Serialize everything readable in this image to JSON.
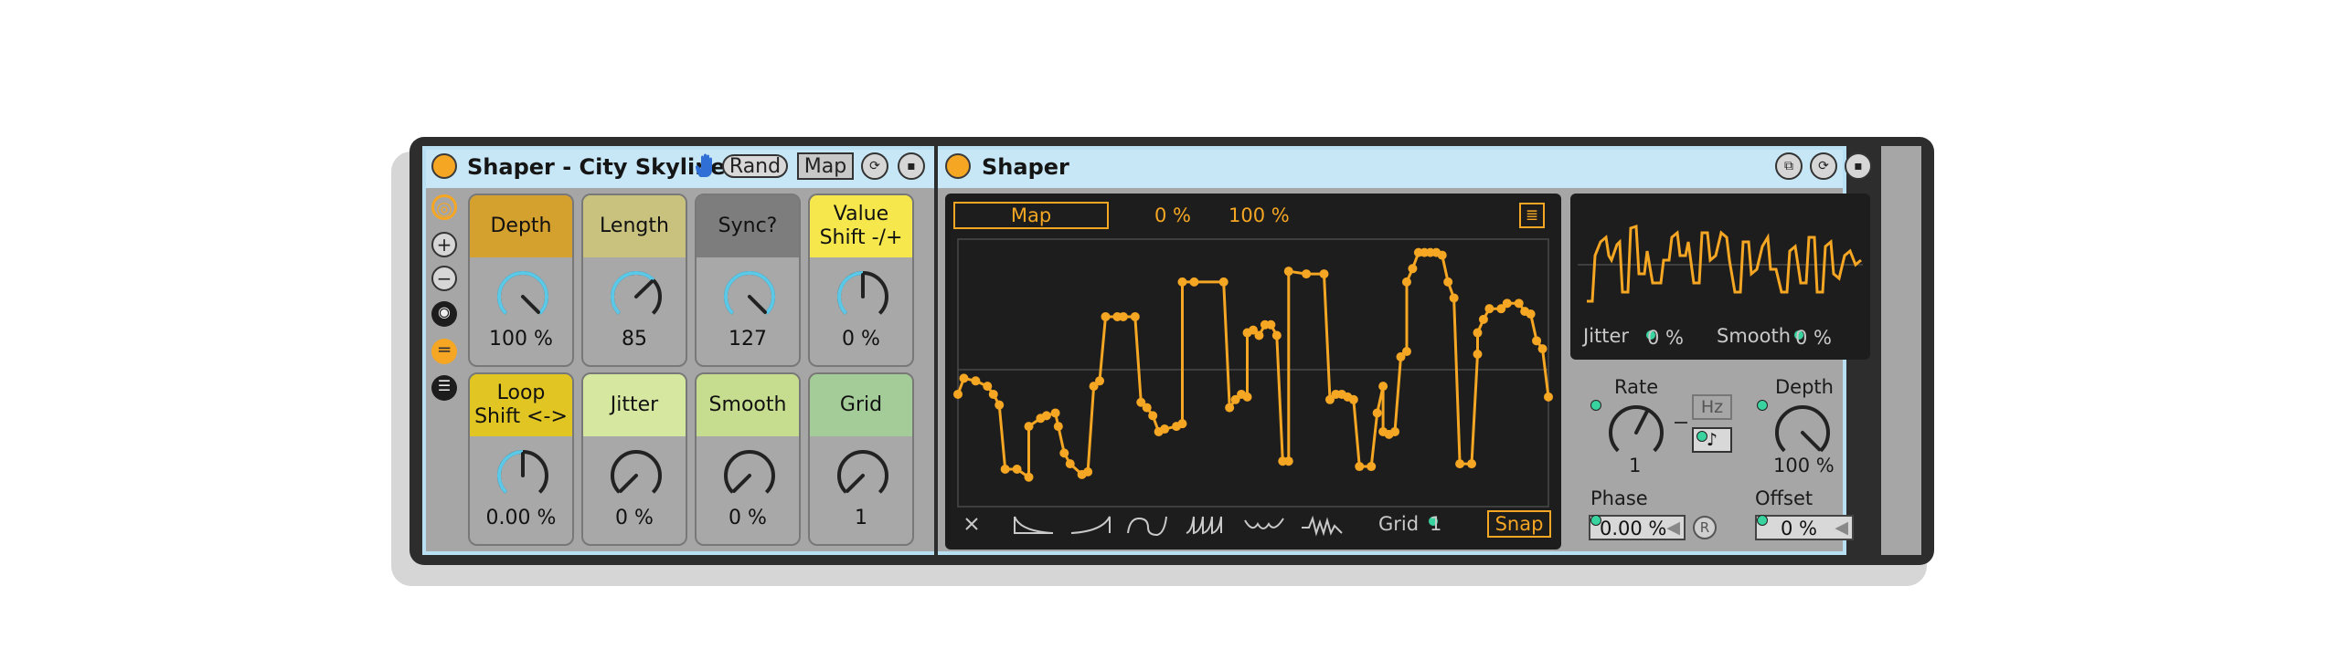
{
  "macro_device": {
    "title": "Shaper - City Skyline",
    "rand_label": "Rand",
    "map_label": "Map",
    "icons": [
      "hand-icon",
      "sync-icon",
      "save-icon"
    ],
    "side_icons": [
      "map-toggle-icon",
      "plus-icon",
      "minus-icon",
      "camera-icon",
      "collapse-icon",
      "list-icon"
    ],
    "knobs": [
      {
        "label": "Depth",
        "value": "100 %",
        "color": "#d4a02e",
        "arc": "#5bc8e8",
        "fraction": 1.0
      },
      {
        "label": "Length",
        "value": "85",
        "color": "#c8c27e",
        "arc": "#5bc8e8",
        "fraction": 0.67
      },
      {
        "label": "Sync?",
        "value": "127",
        "color": "#7d7d7d",
        "arc": "#5bc8e8",
        "fraction": 1.0
      },
      {
        "label": "Value\nShift -/+",
        "value": "0 %",
        "color": "#f6e84c",
        "arc": "#5bc8e8",
        "fraction": 0.5
      },
      {
        "label": "Loop\nShift <->",
        "value": "0.00 %",
        "color": "#e1c522",
        "arc": "#5bc8e8",
        "fraction": 0.5
      },
      {
        "label": "Jitter",
        "value": "0 %",
        "color": "#d6e8a0",
        "arc": "#5bc8e8",
        "fraction": 0.0
      },
      {
        "label": "Smooth",
        "value": "0 %",
        "color": "#c6dc8e",
        "arc": "#5bc8e8",
        "fraction": 0.0
      },
      {
        "label": "Grid",
        "value": "1",
        "color": "#a4cc98",
        "arc": "#5bc8e8",
        "fraction": 0.0
      }
    ]
  },
  "shaper": {
    "title": "Shaper",
    "header_icons": [
      "fold-icon",
      "sync-icon",
      "save-icon"
    ],
    "display": {
      "map_label": "Map",
      "min_label": "0 %",
      "max_label": "100 %",
      "grid_label": "Grid",
      "grid_value": "1",
      "snap_label": "Snap",
      "shape_icons": [
        "clear-icon",
        "decay-shape-icon",
        "rise-shape-icon",
        "s-curve-icon",
        "ramps-icon",
        "bounce-icon",
        "noise-icon"
      ]
    },
    "mini": {
      "jitter_label": "Jitter",
      "jitter_value": "0 %",
      "smooth_label": "Smooth",
      "smooth_value": "0 %"
    },
    "controls": {
      "rate_label": "Rate",
      "rate_value": "1",
      "hz_label": "Hz",
      "note_label": "♪",
      "depth_label": "Depth",
      "depth_value": "100 %",
      "depth_fraction": 1.0,
      "rate_fraction": 0.6,
      "phase_label": "Phase",
      "phase_value": "0.00 %",
      "r_label": "R",
      "offset_label": "Offset",
      "offset_value": "0 %"
    },
    "envelope": [
      [
        0.0,
        0.58
      ],
      [
        0.01,
        0.52
      ],
      [
        0.03,
        0.53
      ],
      [
        0.05,
        0.55
      ],
      [
        0.06,
        0.58
      ],
      [
        0.07,
        0.62
      ],
      [
        0.08,
        0.86
      ],
      [
        0.1,
        0.86
      ],
      [
        0.12,
        0.89
      ],
      [
        0.12,
        0.7
      ],
      [
        0.14,
        0.67
      ],
      [
        0.15,
        0.66
      ],
      [
        0.165,
        0.65
      ],
      [
        0.17,
        0.7
      ],
      [
        0.18,
        0.8
      ],
      [
        0.19,
        0.84
      ],
      [
        0.21,
        0.88
      ],
      [
        0.22,
        0.87
      ],
      [
        0.23,
        0.55
      ],
      [
        0.24,
        0.53
      ],
      [
        0.25,
        0.29
      ],
      [
        0.27,
        0.29
      ],
      [
        0.28,
        0.29
      ],
      [
        0.3,
        0.29
      ],
      [
        0.31,
        0.61
      ],
      [
        0.32,
        0.63
      ],
      [
        0.33,
        0.66
      ],
      [
        0.34,
        0.72
      ],
      [
        0.35,
        0.71
      ],
      [
        0.37,
        0.7
      ],
      [
        0.38,
        0.69
      ],
      [
        0.38,
        0.16
      ],
      [
        0.4,
        0.16
      ],
      [
        0.45,
        0.16
      ],
      [
        0.46,
        0.63
      ],
      [
        0.47,
        0.6
      ],
      [
        0.48,
        0.58
      ],
      [
        0.49,
        0.59
      ],
      [
        0.49,
        0.35
      ],
      [
        0.5,
        0.34
      ],
      [
        0.51,
        0.36
      ],
      [
        0.52,
        0.32
      ],
      [
        0.53,
        0.32
      ],
      [
        0.54,
        0.36
      ],
      [
        0.55,
        0.83
      ],
      [
        0.56,
        0.83
      ],
      [
        0.56,
        0.12
      ],
      [
        0.59,
        0.13
      ],
      [
        0.62,
        0.13
      ],
      [
        0.63,
        0.6
      ],
      [
        0.64,
        0.58
      ],
      [
        0.65,
        0.58
      ],
      [
        0.66,
        0.59
      ],
      [
        0.67,
        0.6
      ],
      [
        0.68,
        0.85
      ],
      [
        0.7,
        0.85
      ],
      [
        0.71,
        0.65
      ],
      [
        0.72,
        0.55
      ],
      [
        0.72,
        0.72
      ],
      [
        0.73,
        0.73
      ],
      [
        0.74,
        0.72
      ],
      [
        0.75,
        0.44
      ],
      [
        0.76,
        0.42
      ],
      [
        0.76,
        0.16
      ],
      [
        0.77,
        0.11
      ],
      [
        0.78,
        0.05
      ],
      [
        0.79,
        0.05
      ],
      [
        0.8,
        0.05
      ],
      [
        0.81,
        0.05
      ],
      [
        0.82,
        0.06
      ],
      [
        0.83,
        0.16
      ],
      [
        0.84,
        0.22
      ],
      [
        0.85,
        0.84
      ],
      [
        0.87,
        0.84
      ],
      [
        0.88,
        0.43
      ],
      [
        0.88,
        0.35
      ],
      [
        0.89,
        0.3
      ],
      [
        0.9,
        0.26
      ],
      [
        0.92,
        0.26
      ],
      [
        0.93,
        0.24
      ],
      [
        0.95,
        0.24
      ],
      [
        0.96,
        0.27
      ],
      [
        0.97,
        0.28
      ],
      [
        0.98,
        0.38
      ],
      [
        0.99,
        0.41
      ],
      [
        1.0,
        0.59
      ]
    ],
    "mini_envelope": [
      [
        0.0,
        0.1
      ],
      [
        0.02,
        0.1
      ],
      [
        0.03,
        0.6
      ],
      [
        0.05,
        0.75
      ],
      [
        0.07,
        0.8
      ],
      [
        0.08,
        0.6
      ],
      [
        0.09,
        0.55
      ],
      [
        0.11,
        0.72
      ],
      [
        0.12,
        0.75
      ],
      [
        0.13,
        0.2
      ],
      [
        0.15,
        0.2
      ],
      [
        0.16,
        0.9
      ],
      [
        0.18,
        0.92
      ],
      [
        0.19,
        0.4
      ],
      [
        0.21,
        0.4
      ],
      [
        0.22,
        0.65
      ],
      [
        0.24,
        0.3
      ],
      [
        0.25,
        0.3
      ],
      [
        0.27,
        0.3
      ],
      [
        0.28,
        0.55
      ],
      [
        0.3,
        0.55
      ],
      [
        0.31,
        0.8
      ],
      [
        0.33,
        0.85
      ],
      [
        0.34,
        0.6
      ],
      [
        0.36,
        0.6
      ],
      [
        0.37,
        0.75
      ],
      [
        0.39,
        0.3
      ],
      [
        0.41,
        0.3
      ],
      [
        0.42,
        0.85
      ],
      [
        0.44,
        0.85
      ],
      [
        0.45,
        0.55
      ],
      [
        0.47,
        0.6
      ],
      [
        0.49,
        0.85
      ],
      [
        0.51,
        0.8
      ],
      [
        0.52,
        0.55
      ],
      [
        0.54,
        0.2
      ],
      [
        0.56,
        0.2
      ],
      [
        0.57,
        0.75
      ],
      [
        0.59,
        0.75
      ],
      [
        0.6,
        0.4
      ],
      [
        0.62,
        0.45
      ],
      [
        0.64,
        0.7
      ],
      [
        0.66,
        0.8
      ],
      [
        0.67,
        0.45
      ],
      [
        0.69,
        0.45
      ],
      [
        0.71,
        0.2
      ],
      [
        0.73,
        0.2
      ],
      [
        0.74,
        0.65
      ],
      [
        0.76,
        0.7
      ],
      [
        0.78,
        0.3
      ],
      [
        0.8,
        0.3
      ],
      [
        0.81,
        0.8
      ],
      [
        0.83,
        0.8
      ],
      [
        0.84,
        0.2
      ],
      [
        0.86,
        0.2
      ],
      [
        0.87,
        0.7
      ],
      [
        0.89,
        0.75
      ],
      [
        0.9,
        0.4
      ],
      [
        0.92,
        0.35
      ],
      [
        0.94,
        0.6
      ],
      [
        0.96,
        0.65
      ],
      [
        0.98,
        0.5
      ],
      [
        1.0,
        0.55
      ]
    ]
  },
  "colors": {
    "accent": "#f5a623",
    "title_bar": "#c7e7f6",
    "knob_arc": "#5bc8e8",
    "mod_dot": "#39d3a0"
  }
}
